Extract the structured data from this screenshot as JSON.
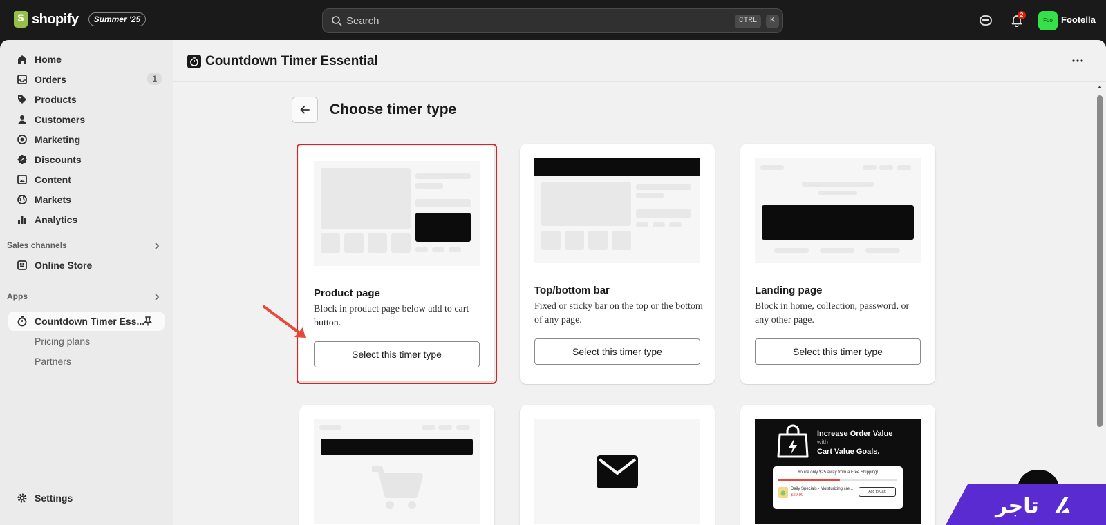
{
  "topbar": {
    "brand": "shopify",
    "edition_badge": "Summer '25",
    "search_placeholder": "Search",
    "shortcut_ctrl": "CTRL",
    "shortcut_k": "K",
    "notification_count": "2",
    "avatar_initials": "Foo",
    "store_name": "Footella",
    "avatar_color": "#36e04b"
  },
  "sidebar": {
    "items": [
      {
        "label": "Home",
        "icon": "home-icon"
      },
      {
        "label": "Orders",
        "icon": "inbox-icon",
        "count": "1"
      },
      {
        "label": "Products",
        "icon": "tag-icon"
      },
      {
        "label": "Customers",
        "icon": "person-icon"
      },
      {
        "label": "Marketing",
        "icon": "target-icon"
      },
      {
        "label": "Discounts",
        "icon": "discount-icon"
      },
      {
        "label": "Content",
        "icon": "image-icon"
      },
      {
        "label": "Markets",
        "icon": "globe-icon"
      },
      {
        "label": "Analytics",
        "icon": "bar-chart-icon"
      }
    ],
    "sales_channels_label": "Sales channels",
    "online_store_label": "Online Store",
    "apps_label": "Apps",
    "active_app_label": "Countdown Timer Ess...",
    "sub_items": [
      "Pricing plans",
      "Partners"
    ],
    "settings_label": "Settings"
  },
  "app": {
    "title": "Countdown Timer Essential",
    "page_title": "Choose timer type"
  },
  "cards": [
    {
      "title": "Product page",
      "description": "Block in product page below add to cart button.",
      "button": "Select this timer type",
      "selected": true
    },
    {
      "title": "Top/bottom bar",
      "description": "Fixed or sticky bar on the top or the bottom of any page.",
      "button": "Select this timer type"
    },
    {
      "title": "Landing page",
      "description": "Block in home, collection, password, or any other page.",
      "button": "Select this timer type"
    }
  ],
  "promo": {
    "headline_1": "Increase Order Value",
    "with": "with",
    "headline_2": "Cart Value Goals.",
    "shipping_text": "You're only $25 away from a Free Shipping!",
    "progress": 0.52,
    "item_name": "Daily Specials - Moisturizing cre...",
    "item_price": "$29.99",
    "add_button": "Add to Cart"
  },
  "watermark": {
    "brand_word": "تاجر",
    "brand_color": "#5a2bd0"
  },
  "colors": {
    "selection_outline": "#e02020",
    "arrow": "#e8473a",
    "topbar_bg": "#1a1a1a"
  }
}
